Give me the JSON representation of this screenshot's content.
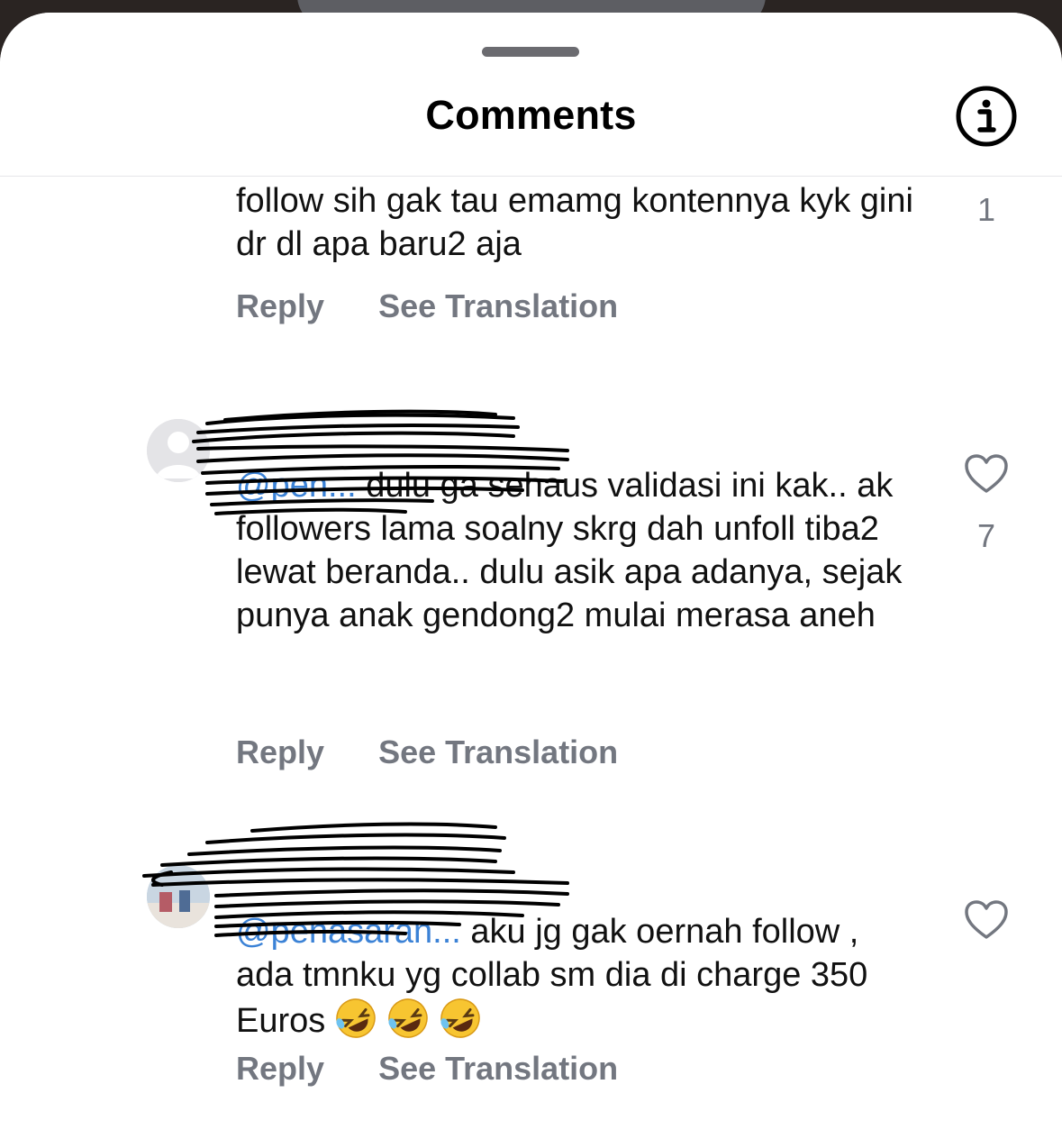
{
  "header": {
    "title": "Comments",
    "info_icon": "info-circle-icon"
  },
  "comments": [
    {
      "text": "follow sih gak tau emamg kontennya kyk gini dr dl apa baru2 aja",
      "like_count": "1",
      "reply_label": "Reply",
      "translate_label": "See Translation"
    },
    {
      "mention": "@pen...",
      "text": " dulu ga sehaus validasi ini kak.. ak followers lama soalny skrg dah unfoll tiba2 lewat beranda.. dulu asik apa adanya, sejak punya anak gendong2 mulai merasa aneh",
      "like_count": "7",
      "reply_label": "Reply",
      "translate_label": "See Translation"
    },
    {
      "mention": "@penasaran...",
      "text": " aku jg gak oernah follow , ada tmnku yg collab sm dia di charge 350 Euros",
      "emojis": [
        "rofl-emoji",
        "rofl-emoji",
        "rofl-emoji"
      ],
      "reply_label": "Reply",
      "translate_label": "See Translation"
    }
  ],
  "colors": {
    "mention": "#3b82d6",
    "secondary_text": "#737780",
    "scribble": "#000000"
  }
}
